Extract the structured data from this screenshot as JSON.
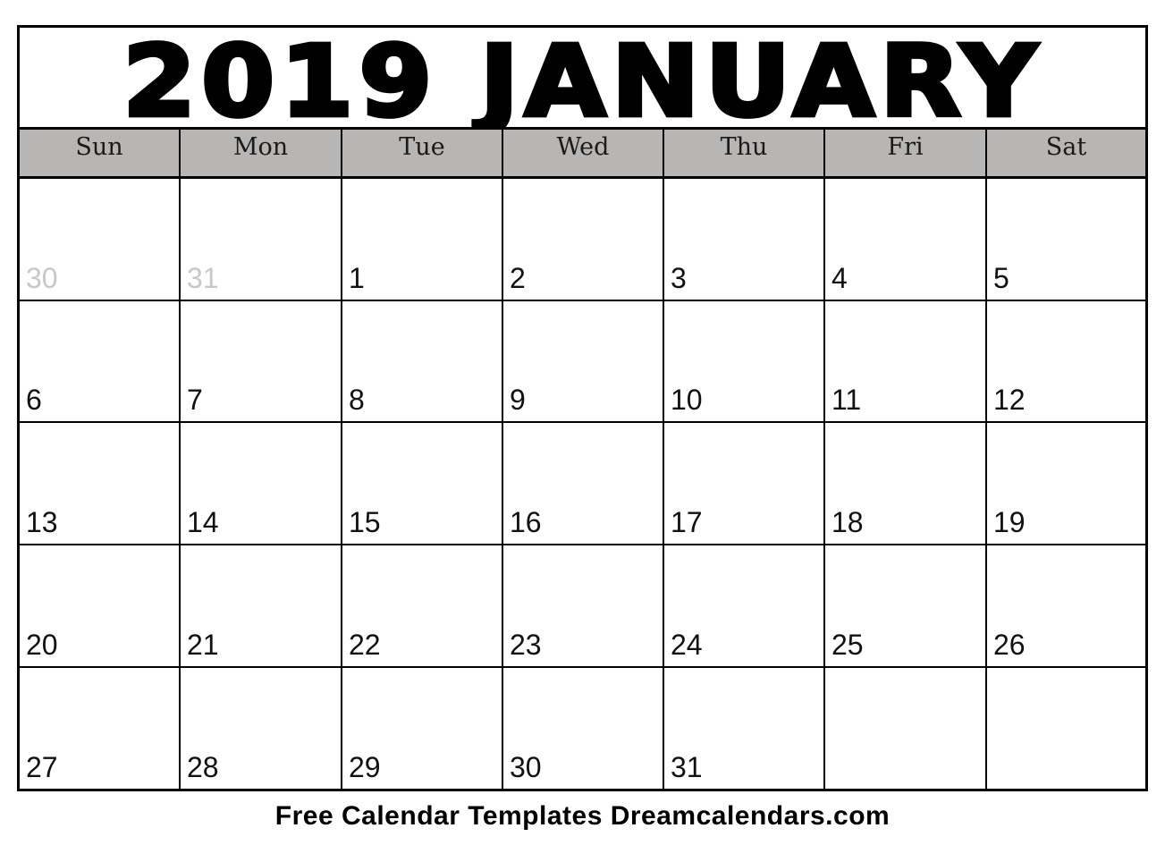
{
  "calendar": {
    "title": "2019 JANUARY",
    "year": "2019",
    "month": "JANUARY",
    "weekdays": [
      "Sun",
      "Mon",
      "Tue",
      "Wed",
      "Thu",
      "Fri",
      "Sat"
    ],
    "weeks": [
      [
        {
          "day": "30",
          "outside_month": true
        },
        {
          "day": "31",
          "outside_month": true
        },
        {
          "day": "1"
        },
        {
          "day": "2"
        },
        {
          "day": "3"
        },
        {
          "day": "4"
        },
        {
          "day": "5"
        }
      ],
      [
        {
          "day": "6"
        },
        {
          "day": "7"
        },
        {
          "day": "8"
        },
        {
          "day": "9"
        },
        {
          "day": "10"
        },
        {
          "day": "11"
        },
        {
          "day": "12"
        }
      ],
      [
        {
          "day": "13"
        },
        {
          "day": "14"
        },
        {
          "day": "15"
        },
        {
          "day": "16"
        },
        {
          "day": "17"
        },
        {
          "day": "18"
        },
        {
          "day": "19"
        }
      ],
      [
        {
          "day": "20"
        },
        {
          "day": "21"
        },
        {
          "day": "22"
        },
        {
          "day": "23"
        },
        {
          "day": "24"
        },
        {
          "day": "25"
        },
        {
          "day": "26"
        }
      ],
      [
        {
          "day": "27"
        },
        {
          "day": "28"
        },
        {
          "day": "29"
        },
        {
          "day": "30"
        },
        {
          "day": "31"
        },
        {
          "day": ""
        },
        {
          "day": ""
        }
      ]
    ]
  },
  "footer": {
    "text": "Free Calendar Templates Dreamcalendars.com"
  },
  "colors": {
    "header_bg": "#b8b6b5",
    "outside_month_text": "#c8c8c8",
    "text": "#000000"
  }
}
